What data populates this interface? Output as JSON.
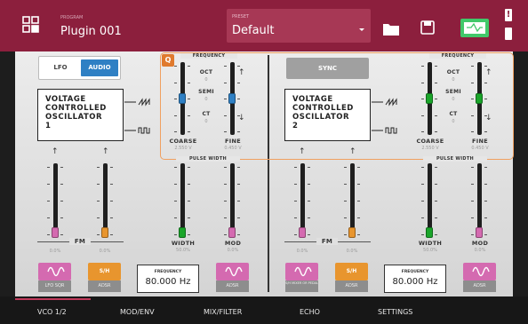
{
  "header": {
    "program_caption": "PROGRAM",
    "program_name": "Plugin 001",
    "preset_caption": "PRESET",
    "preset_name": "Default"
  },
  "colors": {
    "header_bg": "#8c1f3d",
    "panel": "#e0e0e0",
    "blue": "#2f80c4",
    "pink": "#d46ab0",
    "orange": "#e8952e",
    "green": "#1aa52a",
    "highlight": "#f0a060"
  },
  "left": {
    "toggle": {
      "lfo": "LFO",
      "audio": "AUDIO",
      "active": "audio"
    },
    "vco": {
      "line1": "VOLTAGE",
      "line2": "CONTROLLED",
      "line3": "OSCILLATOR",
      "line4": "1"
    },
    "fm_label": "FM",
    "fm1": {
      "value": "0.0%",
      "src": "LFO SQR",
      "level": 0.0
    },
    "fm2": {
      "value": "0.0%",
      "src": "ADSR",
      "level": 0.0
    },
    "freq": {
      "caption": "FREQUENCY",
      "value": "80.000 Hz"
    },
    "q_badge": "Q",
    "frequency_title": "FREQUENCY",
    "coarse": {
      "label": "COARSE",
      "value": "2.550 V",
      "level": 0.5
    },
    "fine": {
      "label": "FINE",
      "value": "0.450 V",
      "level": 0.5
    },
    "readouts": {
      "oct": "OCT",
      "oct_v": "0",
      "semi": "SEMI",
      "semi_v": "0",
      "ct": "CT",
      "ct_v": "0"
    },
    "pw_title": "PULSE WIDTH",
    "width": {
      "label": "WIDTH",
      "value": "50.0%",
      "level": 0.0
    },
    "mod": {
      "label": "MOD",
      "value": "0.0%",
      "src": "ADSR",
      "level": 0.0
    }
  },
  "right": {
    "sync": "SYNC",
    "vco": {
      "line1": "VOLTAGE",
      "line2": "CONTROLLED",
      "line3": "OSCILLATOR",
      "line4": "2"
    },
    "fm_label": "FM",
    "fm1": {
      "value": "0.0%",
      "src": "S/H MIXER OR PEDAL",
      "level": 0.0
    },
    "fm2": {
      "value": "0.0%",
      "src": "ADSR",
      "level": 0.0
    },
    "freq": {
      "caption": "FREQUENCY",
      "value": "80.000 Hz"
    },
    "frequency_title": "FREQUENCY",
    "coarse": {
      "label": "COARSE",
      "value": "2.550 V",
      "level": 0.5
    },
    "fine": {
      "label": "FINE",
      "value": "0.450 V",
      "level": 0.5
    },
    "readouts": {
      "oct": "OCT",
      "oct_v": "0",
      "semi": "SEMI",
      "semi_v": "0",
      "ct": "CT",
      "ct_v": "0"
    },
    "pw_title": "PULSE WIDTH",
    "width": {
      "label": "WIDTH",
      "value": "50.0%",
      "level": 0.0
    },
    "mod": {
      "label": "MOD",
      "value": "0.0%",
      "src": "ADSR",
      "level": 0.0
    }
  },
  "sh_label": "S/H",
  "tabs": [
    "VCO 1/2",
    "MOD/ENV",
    "MIX/FILTER",
    "ECHO",
    "SETTINGS"
  ],
  "active_tab": 0
}
